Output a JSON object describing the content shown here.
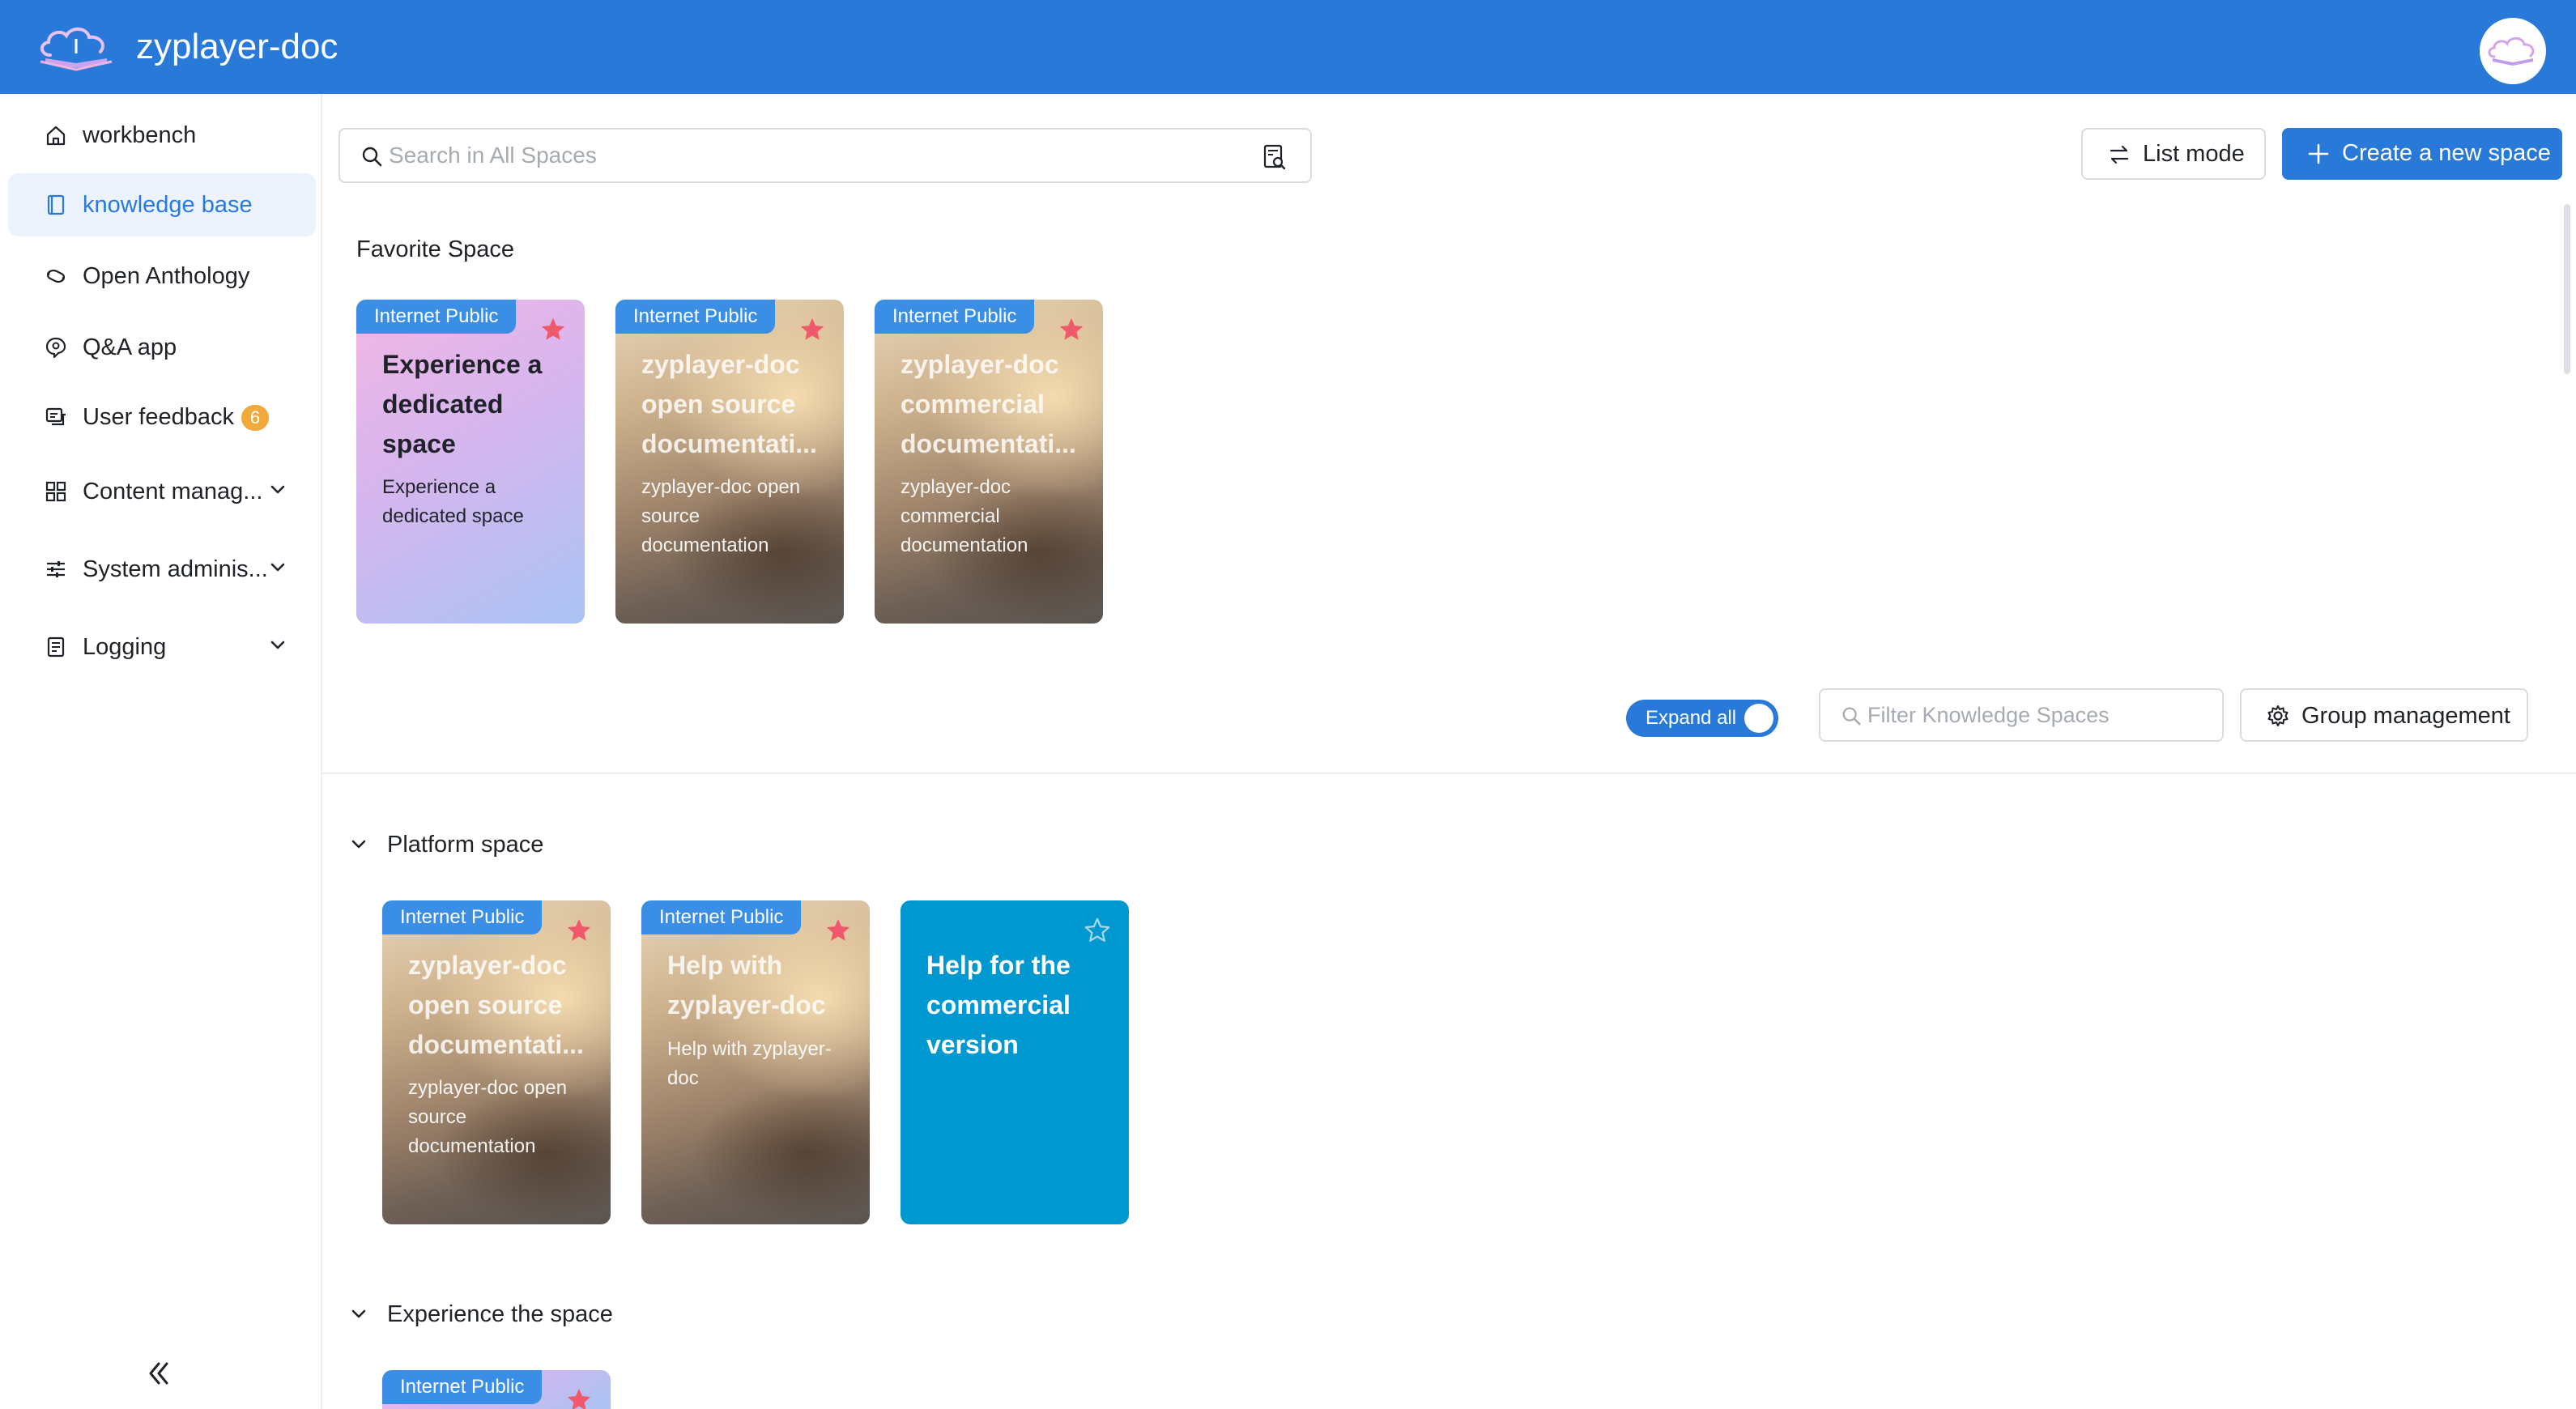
{
  "app": {
    "title": "zyplayer-doc"
  },
  "colors": {
    "header": "#2979d9",
    "accent": "#2979d9",
    "tag": "#3a8ee6",
    "star_filled": "#f0596b",
    "badge": "#f2a93b",
    "teal_card": "#0098d0"
  },
  "sidebar": {
    "items": [
      {
        "label": "workbench",
        "icon": "home-icon"
      },
      {
        "label": "knowledge base",
        "icon": "book-icon",
        "active": true
      },
      {
        "label": "Open Anthology",
        "icon": "link-icon"
      },
      {
        "label": "Q&A app",
        "icon": "chat-bot-icon"
      },
      {
        "label": "User feedback",
        "icon": "feedback-icon",
        "badge": "6"
      },
      {
        "label": "Content manag...",
        "icon": "grid-icon",
        "expandable": true
      },
      {
        "label": "System adminis...",
        "icon": "sliders-icon",
        "expandable": true
      },
      {
        "label": "Logging",
        "icon": "log-icon",
        "expandable": true
      }
    ],
    "collapse_icon": "double-chevron-left-icon"
  },
  "search": {
    "placeholder": "Search in All Spaces",
    "value": ""
  },
  "toolbar": {
    "list_mode_label": "List mode",
    "create_label": "Create a new space"
  },
  "favorites": {
    "title": "Favorite Space",
    "cards": [
      {
        "tag": "Internet Public",
        "title": "Experience a dedicated space",
        "desc": "Experience a dedicated space",
        "style": "gradient",
        "starred": true
      },
      {
        "tag": "Internet Public",
        "title": "zyplayer-doc open source documentati...",
        "desc": "zyplayer-doc open source documentation",
        "style": "book",
        "starred": true
      },
      {
        "tag": "Internet Public",
        "title": "zyplayer-doc commercial documentati...",
        "desc": "zyplayer-doc commercial documentation",
        "style": "book",
        "starred": true
      }
    ]
  },
  "controls": {
    "expand_all_label": "Expand all",
    "expand_all_on": true,
    "filter_placeholder": "Filter Knowledge Spaces",
    "filter_value": "",
    "group_management_label": "Group management"
  },
  "groups": [
    {
      "title": "Platform space",
      "expanded": true,
      "cards": [
        {
          "tag": "Internet Public",
          "title": "zyplayer-doc open source documentati...",
          "desc": "zyplayer-doc open source documentation",
          "style": "book",
          "starred": true
        },
        {
          "tag": "Internet Public",
          "title": "Help with zyplayer-doc",
          "desc": "Help with zyplayer-doc",
          "style": "book",
          "starred": true
        },
        {
          "tag": "",
          "title": "Help for the commercial version",
          "desc": "",
          "style": "teal",
          "starred": false
        }
      ]
    },
    {
      "title": "Experience the space",
      "expanded": true,
      "cards": [
        {
          "tag": "Internet Public",
          "title": "",
          "desc": "",
          "style": "gradient",
          "starred": true
        }
      ]
    }
  ]
}
